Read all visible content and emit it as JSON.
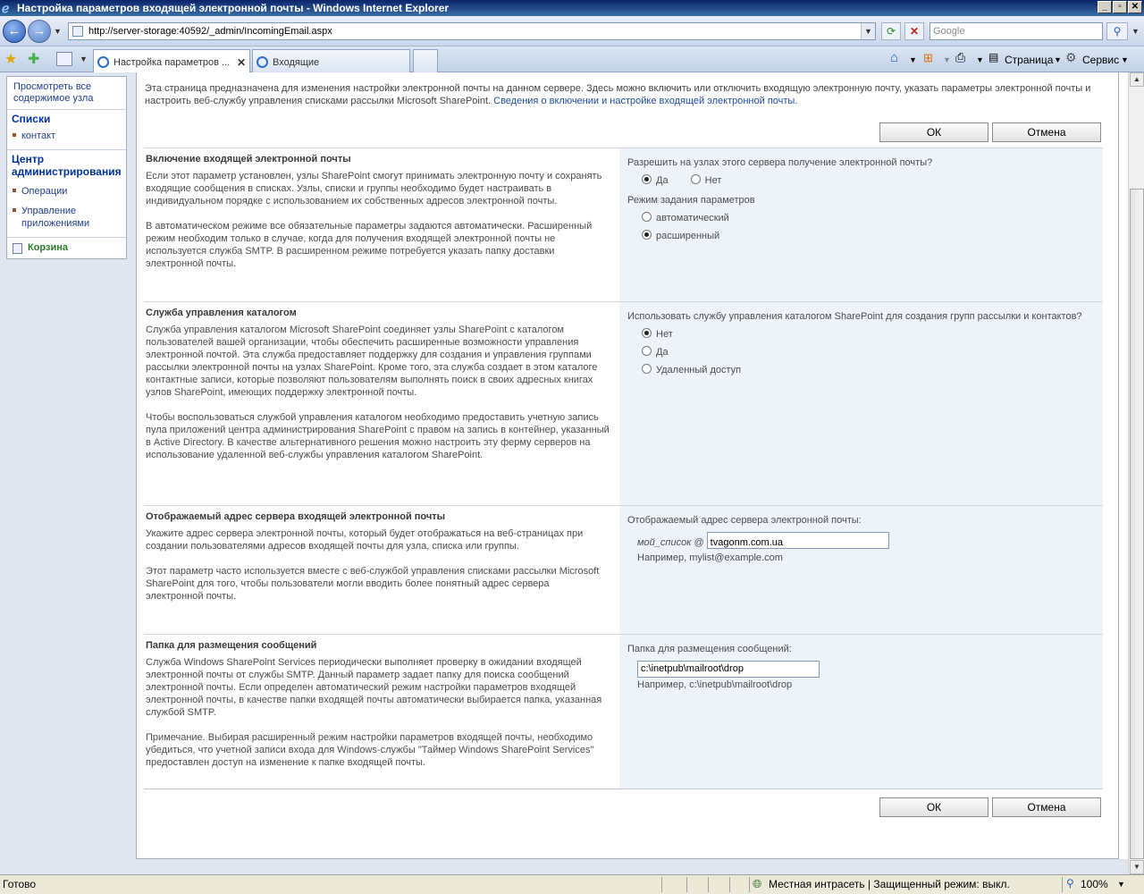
{
  "window": {
    "title": "Настройка параметров входящей электронной почты - Windows Internet Explorer"
  },
  "browser": {
    "url": "http://server-storage:40592/_admin/IncomingEmail.aspx",
    "search_placeholder": "Google",
    "tabs": [
      {
        "label": "Настройка параметров ..."
      },
      {
        "label": "Входящие"
      }
    ],
    "toolbar": {
      "page_label": "Страница",
      "tools_label": "Сервис"
    }
  },
  "sidebar": {
    "view_all": "Просмотреть все содержимое узла",
    "lists_heading": "Списки",
    "lists_items": [
      "контакт"
    ],
    "admin_heading": "Центр администрирования",
    "admin_items": [
      "Операции",
      "Управление приложениями"
    ],
    "recycle_bin": "Корзина"
  },
  "intro": {
    "text": "Эта страница предназначена для изменения настройки электронной почты на данном сервере. Здесь можно включить или отключить входящую электронную почту, указать параметры электронной почты и настроить веб-службу управления списками рассылки Microsoft SharePoint.",
    "link": "Сведения о включении и настройке входящей электронной почты."
  },
  "buttons": {
    "ok": "ОК",
    "cancel": "Отмена"
  },
  "sections": {
    "enable": {
      "title": "Включение входящей электронной почты",
      "p1": "Если этот параметр установлен, узлы SharePoint смогут принимать электронную почту и сохранять входящие сообщения в списках. Узлы, списки и группы необходимо будет настраивать в индивидуальном порядке с использованием их собственных адресов электронной почты.",
      "p2": "В автоматическом режиме все обязательные параметры задаются автоматически. Расширенный режим необходим только в случае, когда для получения входящей электронной почты не используется служба SMTP. В расширенном режиме потребуется указать папку доставки электронной почты.",
      "question": "Разрешить на узлах этого сервера получение электронной почты?",
      "opt_yes": "Да",
      "opt_no": "Нет",
      "mode_label": "Режим задания параметров",
      "mode_auto": "автоматический",
      "mode_advanced": "расширенный"
    },
    "directory": {
      "title": "Служба управления каталогом",
      "p1": "Служба управления каталогом Microsoft SharePoint соединяет узлы SharePoint с каталогом пользователей вашей организации, чтобы обеспечить расширенные возможности управления электронной почтой. Эта служба предоставляет поддержку для создания и управления группами рассылки электронной почты на узлах SharePoint. Кроме того, эта служба создает в этом каталоге контактные записи, которые позволяют пользователям выполнять поиск в своих адресных книгах узлов SharePoint, имеющих поддержку электронной почты.",
      "p2": "Чтобы воспользоваться службой управления каталогом необходимо предоставить учетную запись пула приложений центра администрирования SharePoint с правом на запись в контейнер, указанный в Active Directory. В качестве альтернативного решения можно настроить эту ферму серверов на использование удаленной веб-службы управления каталогом SharePoint.",
      "question": "Использовать службу управления каталогом SharePoint для создания групп рассылки и контактов?",
      "opt_no": "Нет",
      "opt_yes": "Да",
      "opt_remote": "Удаленный доступ"
    },
    "address": {
      "title": "Отображаемый адрес сервера входящей электронной почты",
      "p1": "Укажите адрес сервера электронной почты, который будет отображаться на веб-страницах при создании пользователями адресов входящей почты для узла, списка или группы.",
      "p2": "Этот параметр часто используется вместе с веб-службой управления списками рассылки Microsoft SharePoint для того, чтобы пользователи могли вводить более понятный адрес сервера электронной почты.",
      "label": "Отображаемый адрес сервера электронной почты:",
      "prefix": "мой_список @",
      "value": "tvagonm.com.ua",
      "example": "Например, mylist@example.com"
    },
    "drop": {
      "title": "Папка для размещения сообщений",
      "p1": "Служба Windows SharePoint Services периодически выполняет проверку в ожидании входящей электронной почты от службы SMTP. Данный параметр задает папку для поиска сообщений электронной почты. Если определен автоматический режим настройки параметров входящей электронной почты, в качестве папки входящей почты автоматически выбирается папка, указанная службой SMTP.",
      "p2": "Примечание. Выбирая расширенный режим настройки параметров входящей почты, необходимо убедиться, что учетной записи входа для Windows-службы \"Таймер Windows SharePoint Services\" предоставлен доступ на изменение к папке входящей почты.",
      "label": "Папка для размещения сообщений:",
      "value": "c:\\inetpub\\mailroot\\drop",
      "example": "Например, c:\\inetpub\\mailroot\\drop"
    }
  },
  "status": {
    "left": "Готово",
    "zone": "Местная интрасеть | Защищенный режим: выкл.",
    "zoom": "100%"
  }
}
